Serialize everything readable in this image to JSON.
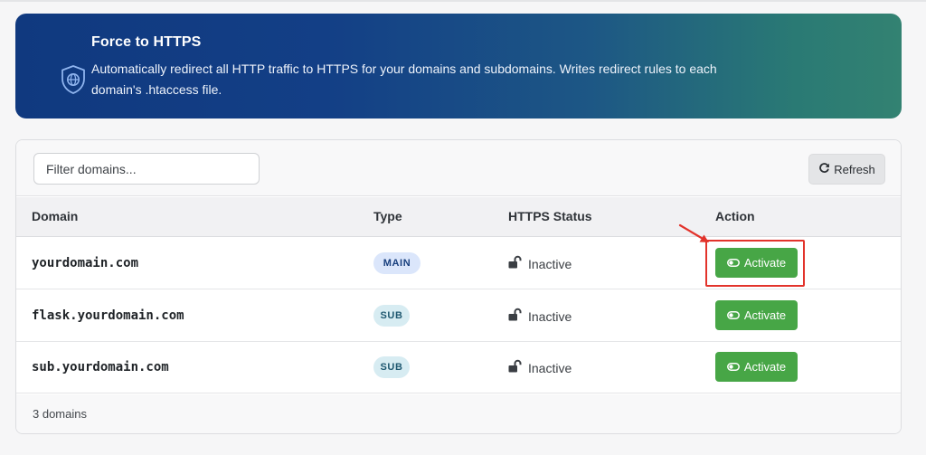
{
  "banner": {
    "title": "Force to HTTPS",
    "description": "Automatically redirect all HTTP traffic to HTTPS for your domains and subdomains. Writes redirect rules to each domain's .htaccess file.",
    "icon": "shield-globe-icon"
  },
  "toolbar": {
    "filter_placeholder": "Filter domains...",
    "refresh_label": "Refresh",
    "refresh_icon": "refresh-icon"
  },
  "table": {
    "headers": {
      "domain": "Domain",
      "type": "Type",
      "status": "HTTPS Status",
      "action": "Action"
    },
    "rows": [
      {
        "domain": "yourdomain.com",
        "type": "MAIN",
        "status": "Inactive",
        "action": "Activate"
      },
      {
        "domain": "flask.yourdomain.com",
        "type": "SUB",
        "status": "Inactive",
        "action": "Activate"
      },
      {
        "domain": "sub.yourdomain.com",
        "type": "SUB",
        "status": "Inactive",
        "action": "Activate"
      }
    ]
  },
  "footer": {
    "count": "3 domains"
  },
  "colors": {
    "banner_start": "#10397f",
    "banner_end": "#338272",
    "activate_green": "#47a646",
    "annotation_red": "#e2332b"
  }
}
